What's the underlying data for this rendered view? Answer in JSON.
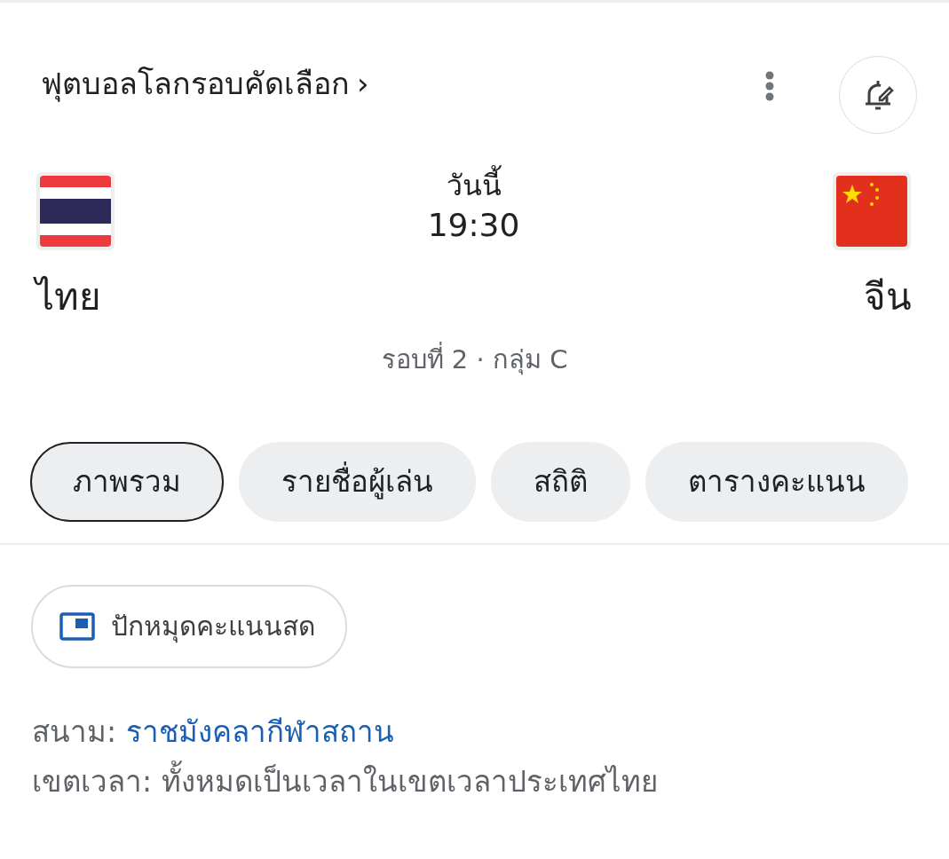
{
  "header": {
    "title": "ฟุตบอลโลกรอบคัดเลือก",
    "chevron": "›"
  },
  "match": {
    "day": "วันนี้",
    "time": "19:30",
    "round": "รอบที่ 2 · กลุ่ม C"
  },
  "teams": [
    {
      "name": "ไทย",
      "kind": "thailand"
    },
    {
      "name": "จีน",
      "kind": "china"
    }
  ],
  "tabs": [
    {
      "label": "ภาพรวม",
      "selected": true
    },
    {
      "label": "รายชื่อผู้เล่น",
      "selected": false
    },
    {
      "label": "สถิติ",
      "selected": false
    },
    {
      "label": "ตารางคะแนน",
      "selected": false
    }
  ],
  "pin_button": {
    "label": "ปักหมุดคะแนนสด"
  },
  "details": [
    {
      "label": "สนาม:",
      "value": "ราชมังคลากีฬาสถาน",
      "kind": "link"
    },
    {
      "label": "เขตเวลา:",
      "value": "ทั้งหมดเป็นเวลาในเขตเวลาประเทศไทย",
      "kind": "text"
    }
  ]
}
